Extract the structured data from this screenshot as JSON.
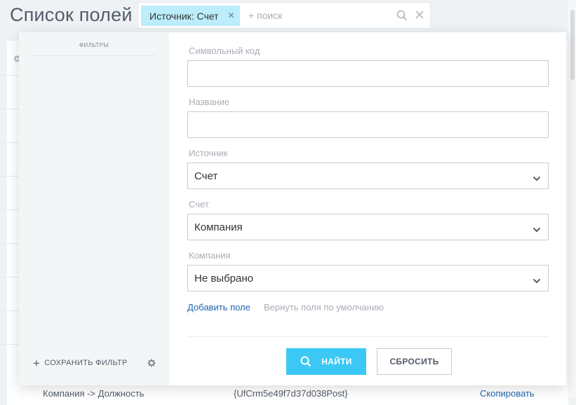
{
  "page": {
    "title": "Список полей"
  },
  "search": {
    "chip_label": "Источник: Счет",
    "add_placeholder": "+ поиск"
  },
  "background_row": {
    "name": "Компания -> Должность",
    "code": "{UfCrm5e49f7d37d038Post}",
    "action": "Скопировать"
  },
  "filter": {
    "sidebar_title": "ФИЛЬТРЫ",
    "save_filter_label": "СОХРАНИТЬ ФИЛЬТР",
    "fields": [
      {
        "label": "Символьный код",
        "type": "text",
        "value": ""
      },
      {
        "label": "Название",
        "type": "text",
        "value": ""
      },
      {
        "label": "Источник",
        "type": "select",
        "value": "Счет"
      },
      {
        "label": "Счет",
        "type": "select",
        "value": "Компания"
      },
      {
        "label": "Компания",
        "type": "select",
        "value": "Не выбрано"
      }
    ],
    "add_field_link": "Добавить поле",
    "restore_fields_link": "Вернуть поля по умолчанию",
    "find_button": "НАЙТИ",
    "reset_button": "СБРОСИТЬ"
  },
  "colors": {
    "accent": "#3bc8f5",
    "chip_bg": "#bcedfc",
    "link": "#2067b0",
    "label_muted": "#a8adb4",
    "sidebar_bg": "#f3f6f7"
  },
  "icons": {
    "chip_remove": "close-icon",
    "search": "search-icon",
    "clear": "close-icon",
    "settings": "gear-icon",
    "dropdown": "chevron-down-icon",
    "add": "plus-icon"
  }
}
